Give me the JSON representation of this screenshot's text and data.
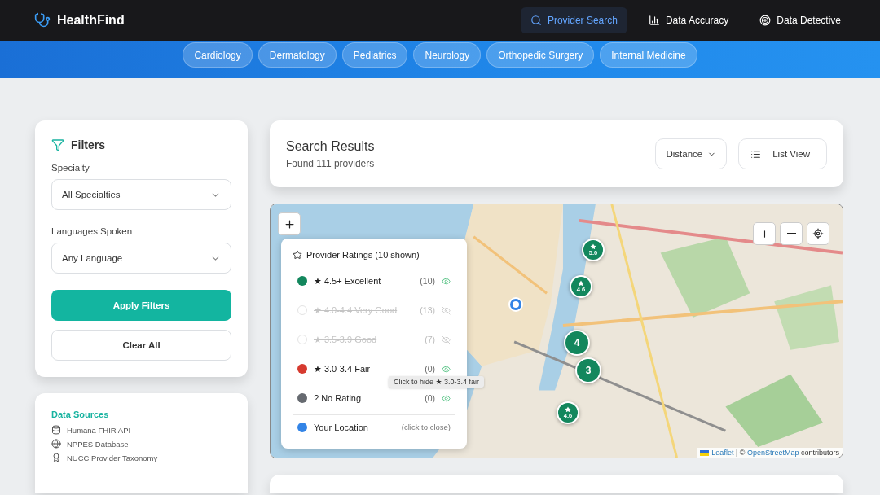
{
  "app": {
    "name": "HealthFind"
  },
  "nav": [
    {
      "label": "Provider Search",
      "selected": true,
      "kind": "search"
    },
    {
      "label": "Data Accuracy",
      "selected": false,
      "kind": "chart"
    },
    {
      "label": "Data Detective",
      "selected": false,
      "kind": "target"
    }
  ],
  "specialties": [
    "Cardiology",
    "Dermatology",
    "Pediatrics",
    "Neurology",
    "Orthopedic Surgery",
    "Internal Medicine"
  ],
  "filters": {
    "title": "Filters",
    "fields": [
      {
        "label": "Specialty",
        "value": "All Specialties"
      },
      {
        "label": "Languages Spoken",
        "value": "Any Language"
      }
    ],
    "buttons": [
      {
        "label": "Apply Filters",
        "kind": "primary"
      },
      {
        "label": "Clear All",
        "kind": "secondary"
      }
    ]
  },
  "data_sources": {
    "title": "Data Sources",
    "items": [
      {
        "label": "Humana FHIR API",
        "kind": "database"
      },
      {
        "label": "NPPES Database",
        "kind": "globe"
      },
      {
        "label": "NUCC Provider Taxonomy",
        "kind": "award"
      }
    ]
  },
  "results": {
    "title": "Search Results",
    "summary": "Found 111 providers",
    "sort": "Distance",
    "view_button": "List View"
  },
  "map": {
    "legend": {
      "title": "Provider Ratings (10 shown)",
      "items": [
        {
          "kind": "rating",
          "label": "★ 4.5+ Excellent",
          "count": "(10)",
          "visible": true,
          "color": "#13875d"
        },
        {
          "kind": "rating",
          "label": "★ 4.0-4.4 Very Good",
          "count": "(13)",
          "visible": false
        },
        {
          "kind": "rating",
          "label": "★ 3.5-3.9 Good",
          "count": "(7)",
          "visible": false
        },
        {
          "kind": "rating",
          "label": "★ 3.0-3.4 Fair",
          "count": "(0)",
          "visible": true,
          "color": "#d63a2f"
        },
        {
          "kind": "rating",
          "label": "? No Rating",
          "count": "(0)",
          "visible": true,
          "color": "#666a70"
        },
        {
          "kind": "location",
          "label": "Your Location",
          "hint": "(click to close)",
          "color": "#3384e6"
        }
      ]
    },
    "tooltip": "Click to hide ★ 3.0-3.4 fair",
    "markers": [
      {
        "label": "5.0",
        "rated": true
      },
      {
        "label": "4.6",
        "rated": true
      },
      {
        "label": "4",
        "rated": false
      },
      {
        "label": "3",
        "rated": false
      },
      {
        "label": "4.6",
        "rated": true
      }
    ],
    "attribution": {
      "link": "Leaflet",
      "middle": "| ©",
      "source": "OpenStreetMap",
      "suffix": "contributors"
    }
  }
}
